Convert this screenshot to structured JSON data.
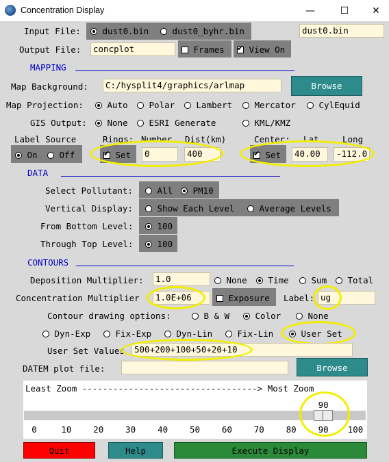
{
  "window": {
    "title": "Concentration Display",
    "minimize": "—",
    "maximize": "☐",
    "close": "✕"
  },
  "input": {
    "label": "Input File:",
    "options": [
      "dust0.bin",
      "dust0_byhr.bin"
    ],
    "selected": "dust0.bin",
    "value": "dust0.bin"
  },
  "output": {
    "label": "Output File:",
    "value": "concplot",
    "frames_label": "Frames",
    "frames_checked": false,
    "view_label": "View On",
    "view_checked": true
  },
  "mapping": {
    "section": "MAPPING",
    "background_label": "Map Background:",
    "background_value": "C:/hysplit4/graphics/arlmap",
    "browse": "Browse",
    "projection_label": "Map Projection:",
    "projection_options": [
      "Auto",
      "Polar",
      "Lambert",
      "Mercator",
      "CylEquid"
    ],
    "projection_selected": "Auto",
    "gis_label": "GIS Output:",
    "gis_options": [
      "None",
      "ESRI Generate",
      "KML/KMZ"
    ],
    "gis_selected": "None",
    "label_source_label": "Label Source",
    "label_source_options": [
      "On",
      "Off"
    ],
    "label_source_selected": "On",
    "rings_label": "Rings:",
    "number_label": "Number",
    "dist_label": "Dist(km)",
    "rings_set_label": "Set",
    "rings_set_checked": true,
    "rings_number": "0",
    "rings_dist": "400",
    "center_label": "Center:",
    "lat_label": "Lat",
    "long_label": "Long",
    "center_set_label": "Set",
    "center_set_checked": true,
    "center_lat": "40.00",
    "center_long": "-112.0"
  },
  "data": {
    "section": "DATA",
    "pollutant_label": "Select Pollutant:",
    "pollutant_options": [
      "All",
      "PM10"
    ],
    "pollutant_selected": "PM10",
    "vertical_label": "Vertical Display:",
    "vertical_options": [
      "Show Each Level",
      "Average Levels"
    ],
    "bottom_label": "From Bottom Level:",
    "bottom_value": "100",
    "top_label": "Through Top Level:",
    "top_value": "100"
  },
  "contours": {
    "section": "CONTOURS",
    "deposition_label": "Deposition Multiplier:",
    "deposition_value": "1.0",
    "deposition_options": [
      "None",
      "Time",
      "Sum",
      "Total"
    ],
    "deposition_selected": "Time",
    "concentration_label": "Concentration Multiplier",
    "concentration_value": "1.0E+06",
    "exposure_label": "Exposure",
    "exposure_checked": false,
    "units_label": "Label:",
    "units_value": "ug",
    "drawing_label": "Contour drawing options:",
    "drawing_options": [
      "B & W",
      "Color",
      "None"
    ],
    "drawing_selected": "Color",
    "levels_options": [
      "Dyn-Exp",
      "Fix-Exp",
      "Dyn-Lin",
      "Fix-Lin",
      "User Set"
    ],
    "levels_selected": "User Set",
    "user_values_label": "User Set Values",
    "user_values": "500+200+100+50+20+10",
    "datem_label": "DATEM plot file:",
    "datem_value": "",
    "browse": "Browse"
  },
  "zoom": {
    "header": "Least Zoom ----------------------------------> Most Zoom",
    "value": 90,
    "min": 0,
    "max": 100,
    "ticks": [
      "0",
      "10",
      "20",
      "30",
      "40",
      "50",
      "60",
      "70",
      "80",
      "90",
      "100"
    ]
  },
  "buttons": {
    "quit": "Quit",
    "help": "Help",
    "execute": "Execute Display"
  },
  "colors": {
    "quit": "#ff0000",
    "help": "#2e8b8b",
    "execute": "#2a8a3a",
    "highlight": "#f2ee00",
    "section": "#0000c8"
  }
}
